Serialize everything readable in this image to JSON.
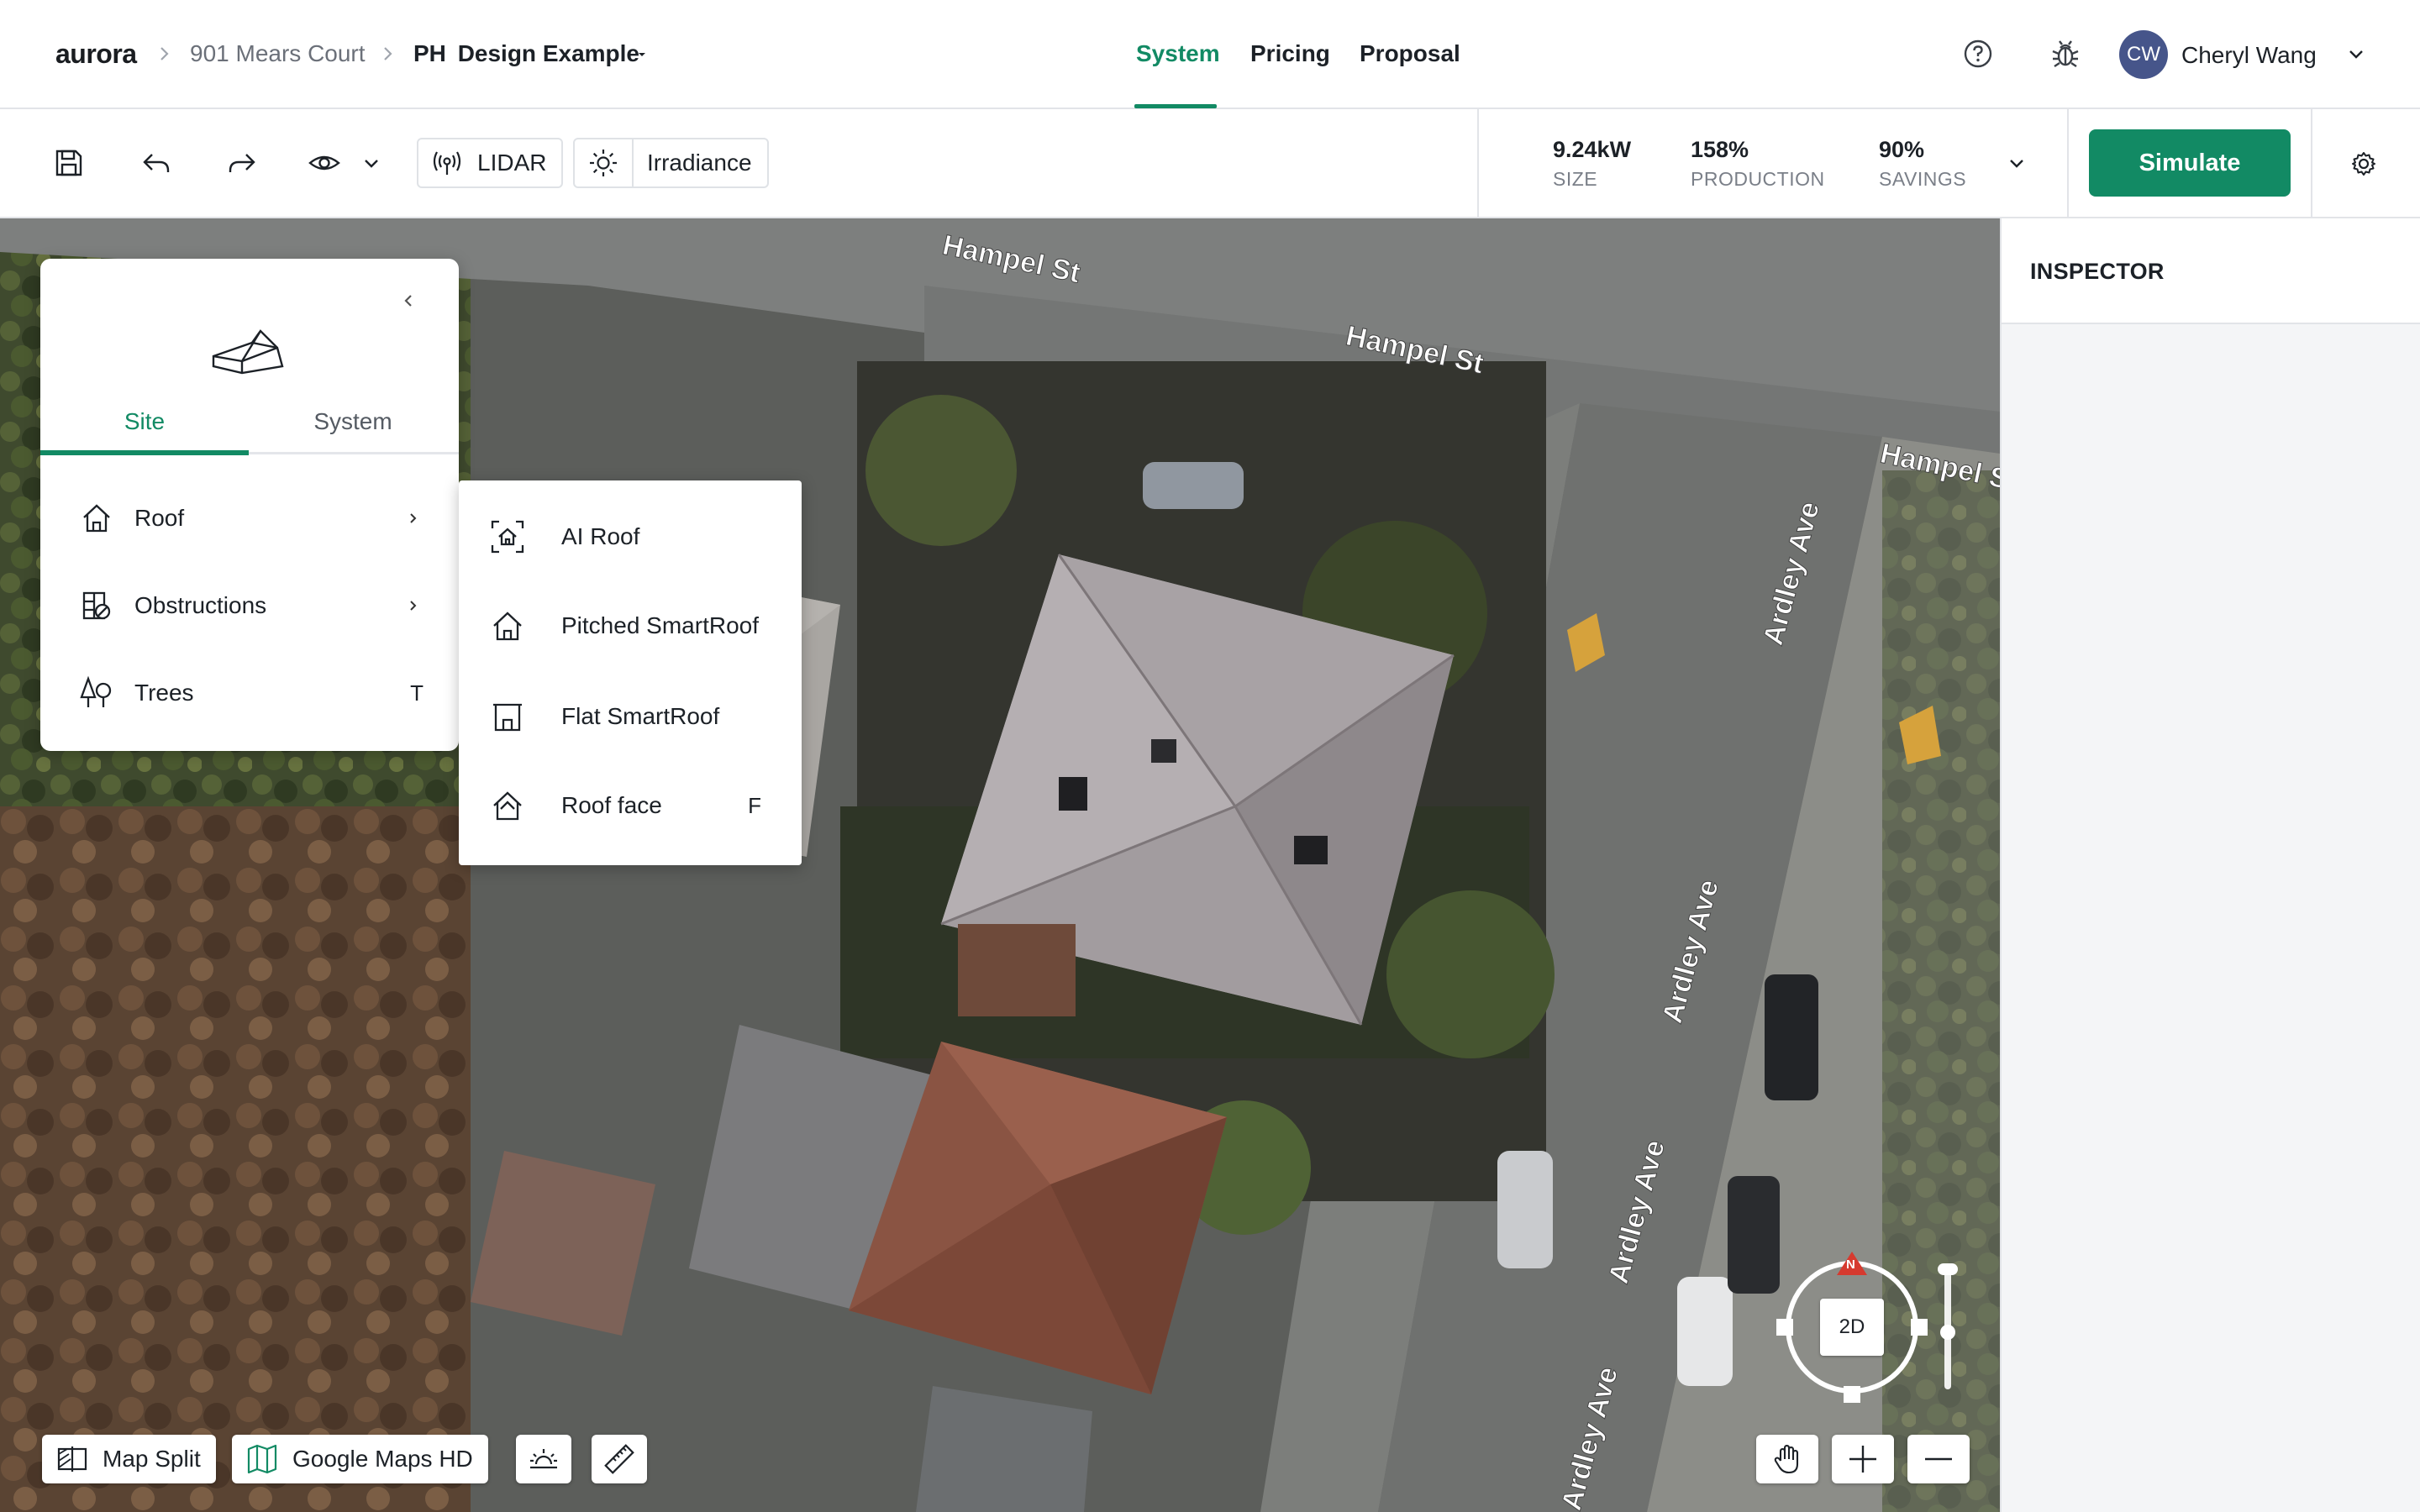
{
  "app": {
    "logo": "aurora"
  },
  "breadcrumb": {
    "project": "901 Mears Court",
    "design_prefix": "PH",
    "design": "Design Example"
  },
  "nav": {
    "tabs": [
      "System",
      "Pricing",
      "Proposal"
    ],
    "active": "System"
  },
  "user": {
    "initials": "CW",
    "name": "Cheryl Wang"
  },
  "toolbar": {
    "lidar_label": "LIDAR",
    "irradiance_label": "Irradiance",
    "stats": [
      {
        "value": "9.24kW",
        "label": "SIZE"
      },
      {
        "value": "158%",
        "label": "PRODUCTION"
      },
      {
        "value": "90%",
        "label": "SAVINGS"
      }
    ],
    "simulate_label": "Simulate"
  },
  "inspector": {
    "title": "INSPECTOR"
  },
  "left_panel": {
    "tabs": [
      "Site",
      "System"
    ],
    "active_tab": "Site",
    "items": [
      {
        "label": "Roof",
        "icon": "house-icon",
        "trailing": "chevron"
      },
      {
        "label": "Obstructions",
        "icon": "obstructions-icon",
        "trailing": "chevron"
      },
      {
        "label": "Trees",
        "icon": "trees-icon",
        "shortcut": "T"
      }
    ]
  },
  "roof_submenu": {
    "items": [
      {
        "label": "AI Roof",
        "icon": "ai-roof-icon"
      },
      {
        "label": "Pitched SmartRoof",
        "icon": "pitched-roof-icon"
      },
      {
        "label": "Flat SmartRoof",
        "icon": "flat-roof-icon"
      },
      {
        "label": "Roof face",
        "icon": "roof-face-icon",
        "shortcut": "F"
      }
    ]
  },
  "map": {
    "street_labels": [
      "Hampel St",
      "Hampel St",
      "Hampel St",
      "Ardley Ave",
      "Ardley Ave",
      "Ardley Ave",
      "Ardley Ave"
    ],
    "compass_north": "N",
    "view_mode": "2D",
    "bottom_controls": {
      "map_split_label": "Map Split",
      "imagery_label": "Google Maps HD"
    }
  },
  "colors": {
    "accent": "#128a64",
    "avatar": "#46558a",
    "compass_north": "#d63a2f"
  }
}
